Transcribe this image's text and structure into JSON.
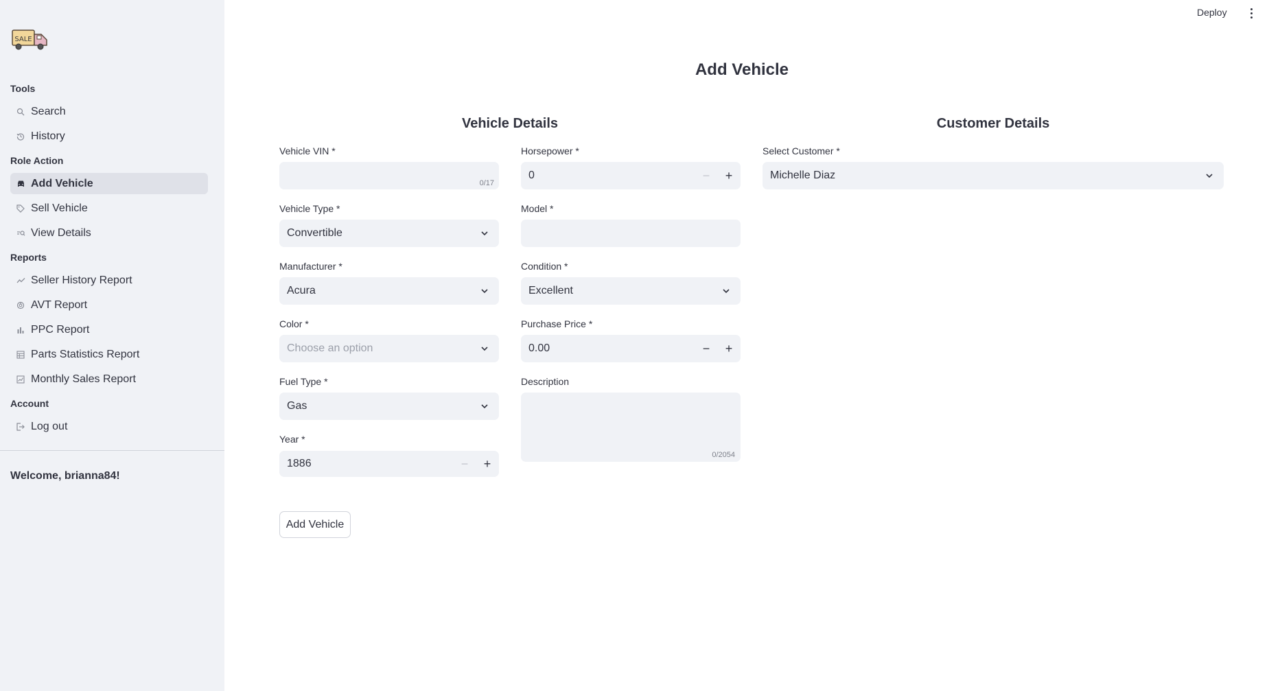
{
  "sidebar": {
    "logo_text": "SALE",
    "sections": {
      "tools": "Tools",
      "role_action": "Role Action",
      "reports": "Reports",
      "account": "Account"
    },
    "items": [
      {
        "label": "Search",
        "icon": "search-icon"
      },
      {
        "label": "History",
        "icon": "history-icon"
      },
      {
        "label": "Add Vehicle",
        "icon": "car-icon",
        "active": true
      },
      {
        "label": "Sell Vehicle",
        "icon": "tag-icon"
      },
      {
        "label": "View Details",
        "icon": "person-search-icon"
      },
      {
        "label": "Seller History Report",
        "icon": "trend-icon"
      },
      {
        "label": "AVT Report",
        "icon": "donut-icon"
      },
      {
        "label": "PPC Report",
        "icon": "bar-chart-icon"
      },
      {
        "label": "Parts Statistics Report",
        "icon": "table-icon"
      },
      {
        "label": "Monthly Sales Report",
        "icon": "line-chart-icon"
      },
      {
        "label": "Log out",
        "icon": "logout-icon"
      }
    ],
    "welcome": "Welcome, brianna84!"
  },
  "header": {
    "deploy": "Deploy"
  },
  "page": {
    "title": "Add Vehicle",
    "vehicle_details_title": "Vehicle Details",
    "customer_details_title": "Customer Details"
  },
  "form": {
    "vin": {
      "label": "Vehicle VIN *",
      "value": "",
      "counter": "0/17"
    },
    "horsepower": {
      "label": "Horsepower *",
      "value": "0"
    },
    "vehicle_type": {
      "label": "Vehicle Type *",
      "value": "Convertible"
    },
    "model": {
      "label": "Model *",
      "value": ""
    },
    "manufacturer": {
      "label": "Manufacturer *",
      "value": "Acura"
    },
    "condition": {
      "label": "Condition *",
      "value": "Excellent"
    },
    "color": {
      "label": "Color *",
      "placeholder": "Choose an option"
    },
    "purchase_price": {
      "label": "Purchase Price *",
      "value": "0.00"
    },
    "fuel_type": {
      "label": "Fuel Type *",
      "value": "Gas"
    },
    "description": {
      "label": "Description",
      "counter": "0/2054"
    },
    "year": {
      "label": "Year *",
      "value": "1886"
    },
    "customer": {
      "label": "Select Customer *",
      "value": "Michelle Diaz"
    },
    "submit_label": "Add Vehicle"
  },
  "colors": {
    "sidebar_bg": "#f0f2f6",
    "input_bg": "#f0f2f6",
    "text": "#31333f",
    "active_item_bg": "#dfe1e8"
  }
}
